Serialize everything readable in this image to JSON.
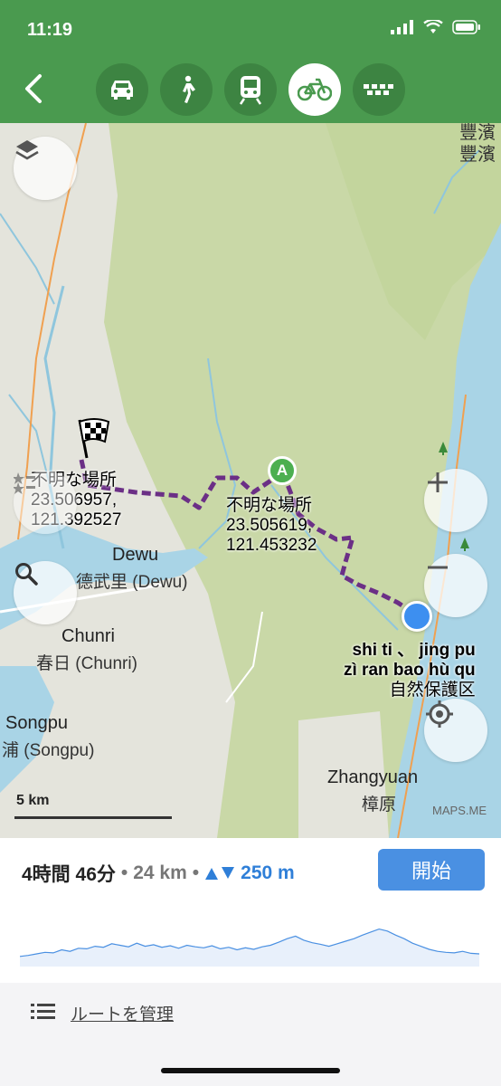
{
  "status": {
    "time": "11:19"
  },
  "modes": [
    {
      "name": "car"
    },
    {
      "name": "walk"
    },
    {
      "name": "transit"
    },
    {
      "name": "bike",
      "active": true
    },
    {
      "name": "taxi"
    }
  ],
  "map": {
    "top_partial": {
      "text": "豐濱",
      "text2": "豐濱"
    },
    "labels": {
      "dewu_en": "Dewu",
      "dewu_jp": "德武里 (Dewu)",
      "chunri_en": "Chunri",
      "chunri_jp": "春日 (Chunri)",
      "songpu_en": "Songpu",
      "songpu_jp": "浦 (Songpu)",
      "zhangyuan_en": "Zhangyuan",
      "zhangyuan_jp": "樟原"
    },
    "pin_start": {
      "title": "不明な場所",
      "line1": "23.506957,",
      "line2": "121.392527"
    },
    "pin_a": {
      "marker": "A",
      "title": "不明な場所",
      "line1": "23.505619,",
      "line2": "121.453232"
    },
    "current": {
      "line1": "shi ti 、 jing pu",
      "line2": "zì ran bao hù qu",
      "line3": "自然保護区"
    },
    "scale": "5 km",
    "attribution": "MAPS.ME"
  },
  "route": {
    "duration": "4時間 46分",
    "distance": "24 km",
    "elevation": "250 m",
    "start_label": "開始",
    "elevation_profile": [
      0.2,
      0.22,
      0.25,
      0.28,
      0.27,
      0.33,
      0.3,
      0.36,
      0.35,
      0.4,
      0.38,
      0.45,
      0.42,
      0.39,
      0.46,
      0.4,
      0.43,
      0.38,
      0.41,
      0.36,
      0.42,
      0.39,
      0.37,
      0.41,
      0.35,
      0.38,
      0.33,
      0.37,
      0.34,
      0.39,
      0.42,
      0.48,
      0.55,
      0.6,
      0.52,
      0.47,
      0.44,
      0.4,
      0.45,
      0.5,
      0.55,
      0.62,
      0.68,
      0.74,
      0.7,
      0.62,
      0.55,
      0.46,
      0.4,
      0.34,
      0.3,
      0.28,
      0.27,
      0.3,
      0.26,
      0.25
    ]
  },
  "manage": {
    "label": "ルートを管理"
  }
}
